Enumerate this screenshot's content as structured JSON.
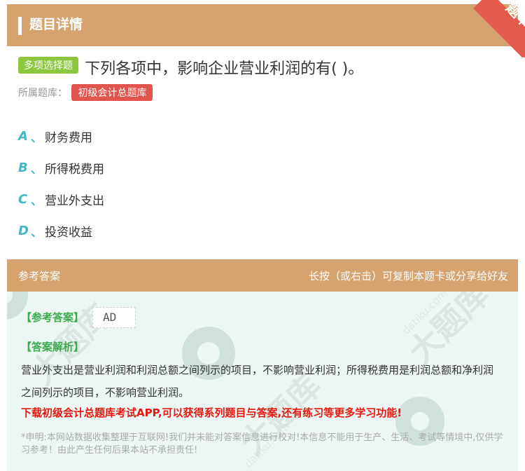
{
  "header": {
    "title": "题目详情",
    "ribbon": "题卡"
  },
  "question": {
    "type_badge": "多项选择题",
    "text": "下列各项中，影响企业营业利润的有( )。"
  },
  "bank": {
    "label": "所属题库：",
    "tag": "初级会计总题库"
  },
  "options": [
    {
      "letter": "A",
      "sep": "、",
      "text": "财务费用"
    },
    {
      "letter": "B",
      "sep": "、",
      "text": "所得税费用"
    },
    {
      "letter": "C",
      "sep": "、",
      "text": "营业外支出"
    },
    {
      "letter": "D",
      "sep": "、",
      "text": "投资收益"
    }
  ],
  "answer_section": {
    "title": "参考答案",
    "share_hint": "长按（或右击）可复制本题卡或分享给好友",
    "answer_label": "【参考答案】",
    "answer_value": "AD",
    "analysis_label": "【答案解析】",
    "analysis_text": "营业外支出是营业利润和利润总额之间列示的项目，不影响营业利润；所得税费用是利润总额和净利润之间列示的项目，不影响营业利润。",
    "promo": "下载初级会计总题库考试APP,可以获得系列题目与答案,还有练习等更多学习功能!",
    "disclaimer": "*申明:本网站数据收集整理于互联网!我们并未能对答案信息进行校对!本信息不能用于生产、生活、考试等情境中,仅供学习参考！由此产生任何后果本站不承担责任!"
  },
  "watermark": {
    "text": "大题库",
    "site": "datiku.com"
  },
  "colors": {
    "header_bg": "#d6a36e",
    "ribbon": "#e25b4d",
    "badge_green": "#8dc63f",
    "tag_red": "#e2554d",
    "option_letter": "#41b8c4",
    "answer_green": "#3aab4a",
    "promo_red": "#e8170f",
    "answer_bg": "#ecf6f3"
  }
}
